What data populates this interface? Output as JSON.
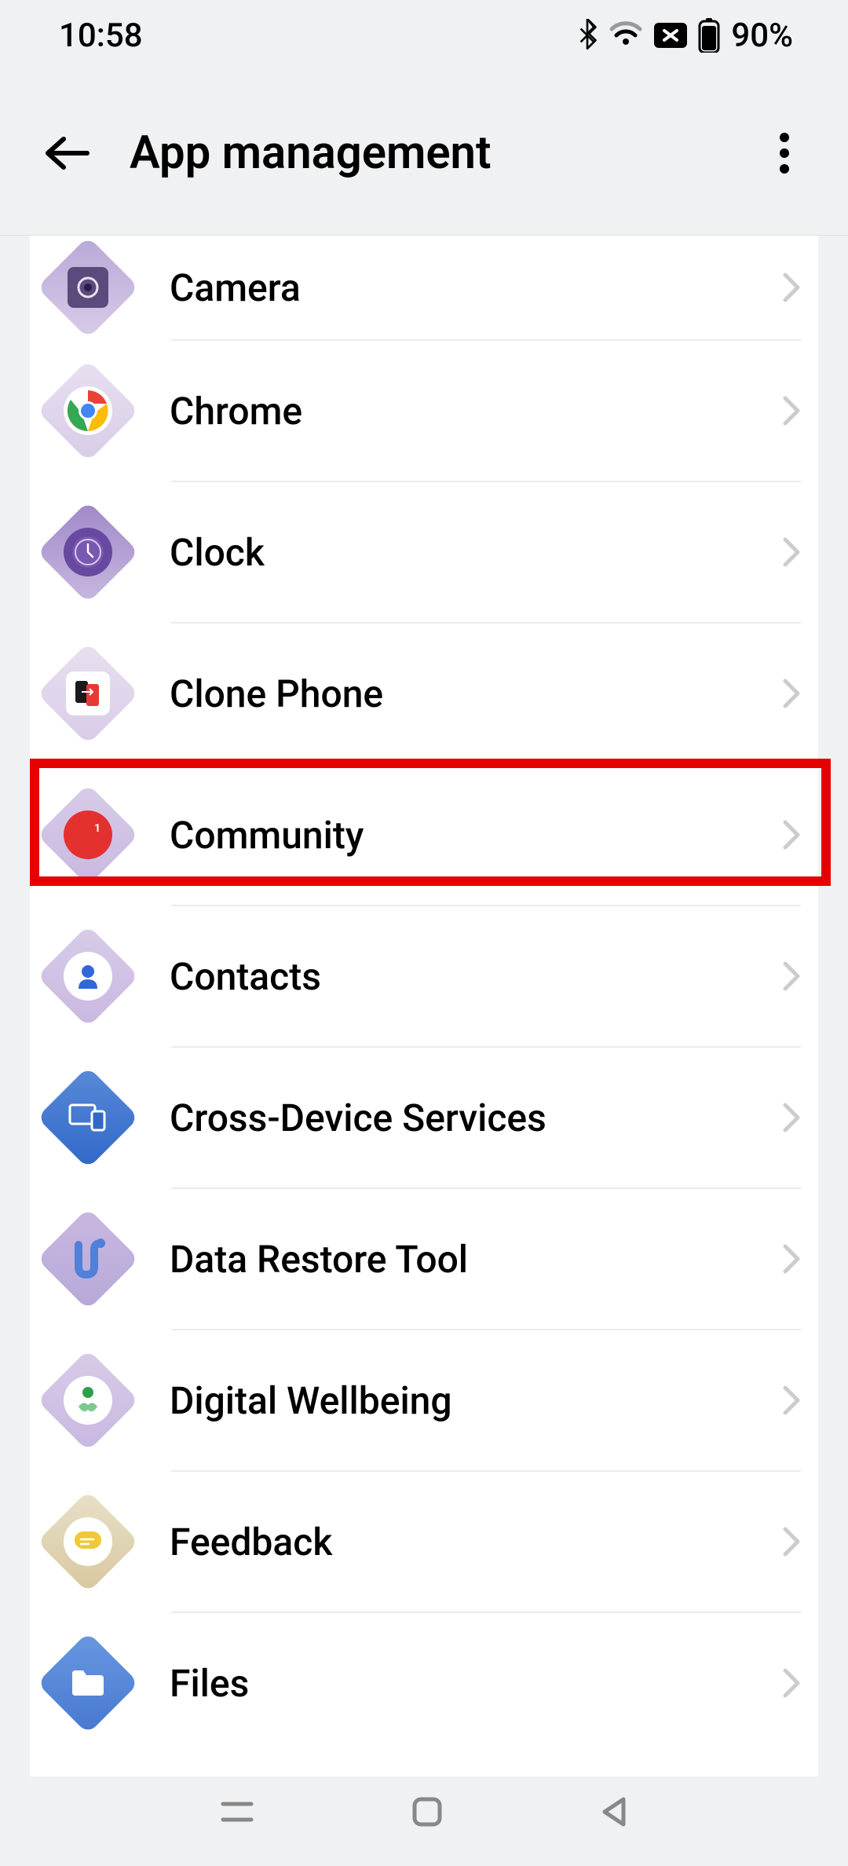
{
  "statusBar": {
    "time": "10:58",
    "battery": "90%"
  },
  "header": {
    "title": "App management"
  },
  "apps": [
    {
      "name": "Camera"
    },
    {
      "name": "Chrome"
    },
    {
      "name": "Clock"
    },
    {
      "name": "Clone Phone"
    },
    {
      "name": "Community"
    },
    {
      "name": "Contacts"
    },
    {
      "name": "Cross-Device Services"
    },
    {
      "name": "Data Restore Tool"
    },
    {
      "name": "Digital Wellbeing"
    },
    {
      "name": "Feedback"
    },
    {
      "name": "Files"
    }
  ],
  "highlightedIndex": 4
}
